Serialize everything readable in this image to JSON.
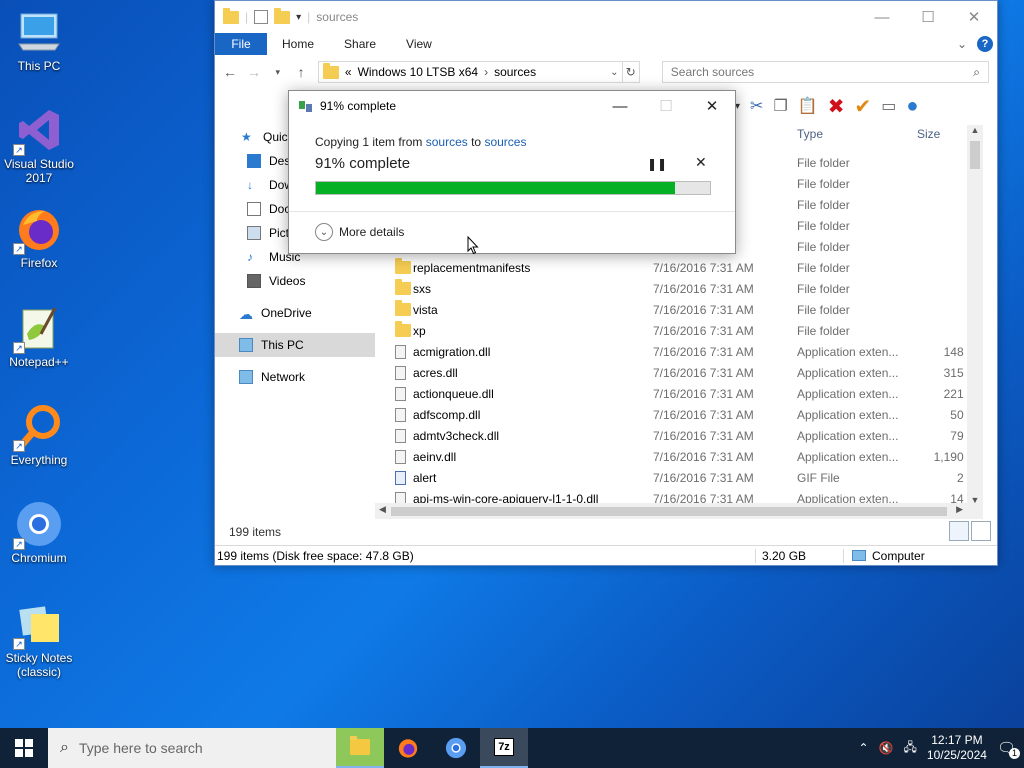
{
  "desktop": {
    "icons": [
      {
        "label": "This PC"
      },
      {
        "label": "Visual Studio 2017"
      },
      {
        "label": "Firefox"
      },
      {
        "label": "Notepad++"
      },
      {
        "label": "Everything"
      },
      {
        "label": "Chromium"
      },
      {
        "label": "Sticky Notes (classic)"
      }
    ]
  },
  "explorer": {
    "title": "sources",
    "ribbon": {
      "file": "File",
      "tabs": [
        "Home",
        "Share",
        "View"
      ],
      "help": "?"
    },
    "address": {
      "prefix": "«",
      "parts": [
        "Windows 10 LTSB x64",
        "sources"
      ],
      "sep": "›"
    },
    "search_placeholder": "Search sources",
    "sidebar": [
      {
        "label": "Quick access"
      },
      {
        "label": "Desktop"
      },
      {
        "label": "Downloads"
      },
      {
        "label": "Documents"
      },
      {
        "label": "Pictures"
      },
      {
        "label": "Music"
      },
      {
        "label": "Videos"
      },
      {
        "label": "OneDrive"
      },
      {
        "label": "This PC"
      },
      {
        "label": "Network"
      }
    ],
    "columns": {
      "type": "Type",
      "size": "Size"
    },
    "files": [
      {
        "name": "",
        "date": "",
        "type": "File folder",
        "size": ""
      },
      {
        "name": "",
        "date": "",
        "type": "File folder",
        "size": ""
      },
      {
        "name": "",
        "date": "",
        "type": "File folder",
        "size": ""
      },
      {
        "name": "",
        "date": "",
        "type": "File folder",
        "size": ""
      },
      {
        "name": "",
        "date": "",
        "type": "File folder",
        "size": ""
      },
      {
        "name": "replacementmanifests",
        "date": "7/16/2016 7:31 AM",
        "type": "File folder",
        "size": ""
      },
      {
        "name": "sxs",
        "date": "7/16/2016 7:31 AM",
        "type": "File folder",
        "size": ""
      },
      {
        "name": "vista",
        "date": "7/16/2016 7:31 AM",
        "type": "File folder",
        "size": ""
      },
      {
        "name": "xp",
        "date": "7/16/2016 7:31 AM",
        "type": "File folder",
        "size": ""
      },
      {
        "name": "acmigration.dll",
        "date": "7/16/2016 7:31 AM",
        "type": "Application exten...",
        "size": "148 KB"
      },
      {
        "name": "acres.dll",
        "date": "7/16/2016 7:31 AM",
        "type": "Application exten...",
        "size": "315 KB"
      },
      {
        "name": "actionqueue.dll",
        "date": "7/16/2016 7:31 AM",
        "type": "Application exten...",
        "size": "221 KB"
      },
      {
        "name": "adfscomp.dll",
        "date": "7/16/2016 7:31 AM",
        "type": "Application exten...",
        "size": "50 KB"
      },
      {
        "name": "admtv3check.dll",
        "date": "7/16/2016 7:31 AM",
        "type": "Application exten...",
        "size": "79 KB"
      },
      {
        "name": "aeinv.dll",
        "date": "7/16/2016 7:31 AM",
        "type": "Application exten...",
        "size": "1,190 KB"
      },
      {
        "name": "alert",
        "date": "7/16/2016 7:31 AM",
        "type": "GIF File",
        "size": "2 KB"
      },
      {
        "name": "api-ms-win-core-apiquery-l1-1-0.dll",
        "date": "7/16/2016 7:31 AM",
        "type": "Application exten...",
        "size": "14 KB"
      }
    ],
    "item_count": "199 items",
    "status": {
      "left": "199 items (Disk free space: 47.8 GB)",
      "size": "3.20 GB",
      "location": "Computer"
    }
  },
  "dialog": {
    "title": "91% complete",
    "copy_prefix": "Copying 1 item from",
    "from": "sources",
    "to_word": "to",
    "to": "sources",
    "percent_text": "91% complete",
    "progress": 0.91,
    "more_details": "More details"
  },
  "taskbar": {
    "search_placeholder": "Type here to search",
    "time": "12:17 PM",
    "date": "10/25/2024",
    "notification_count": "1"
  }
}
